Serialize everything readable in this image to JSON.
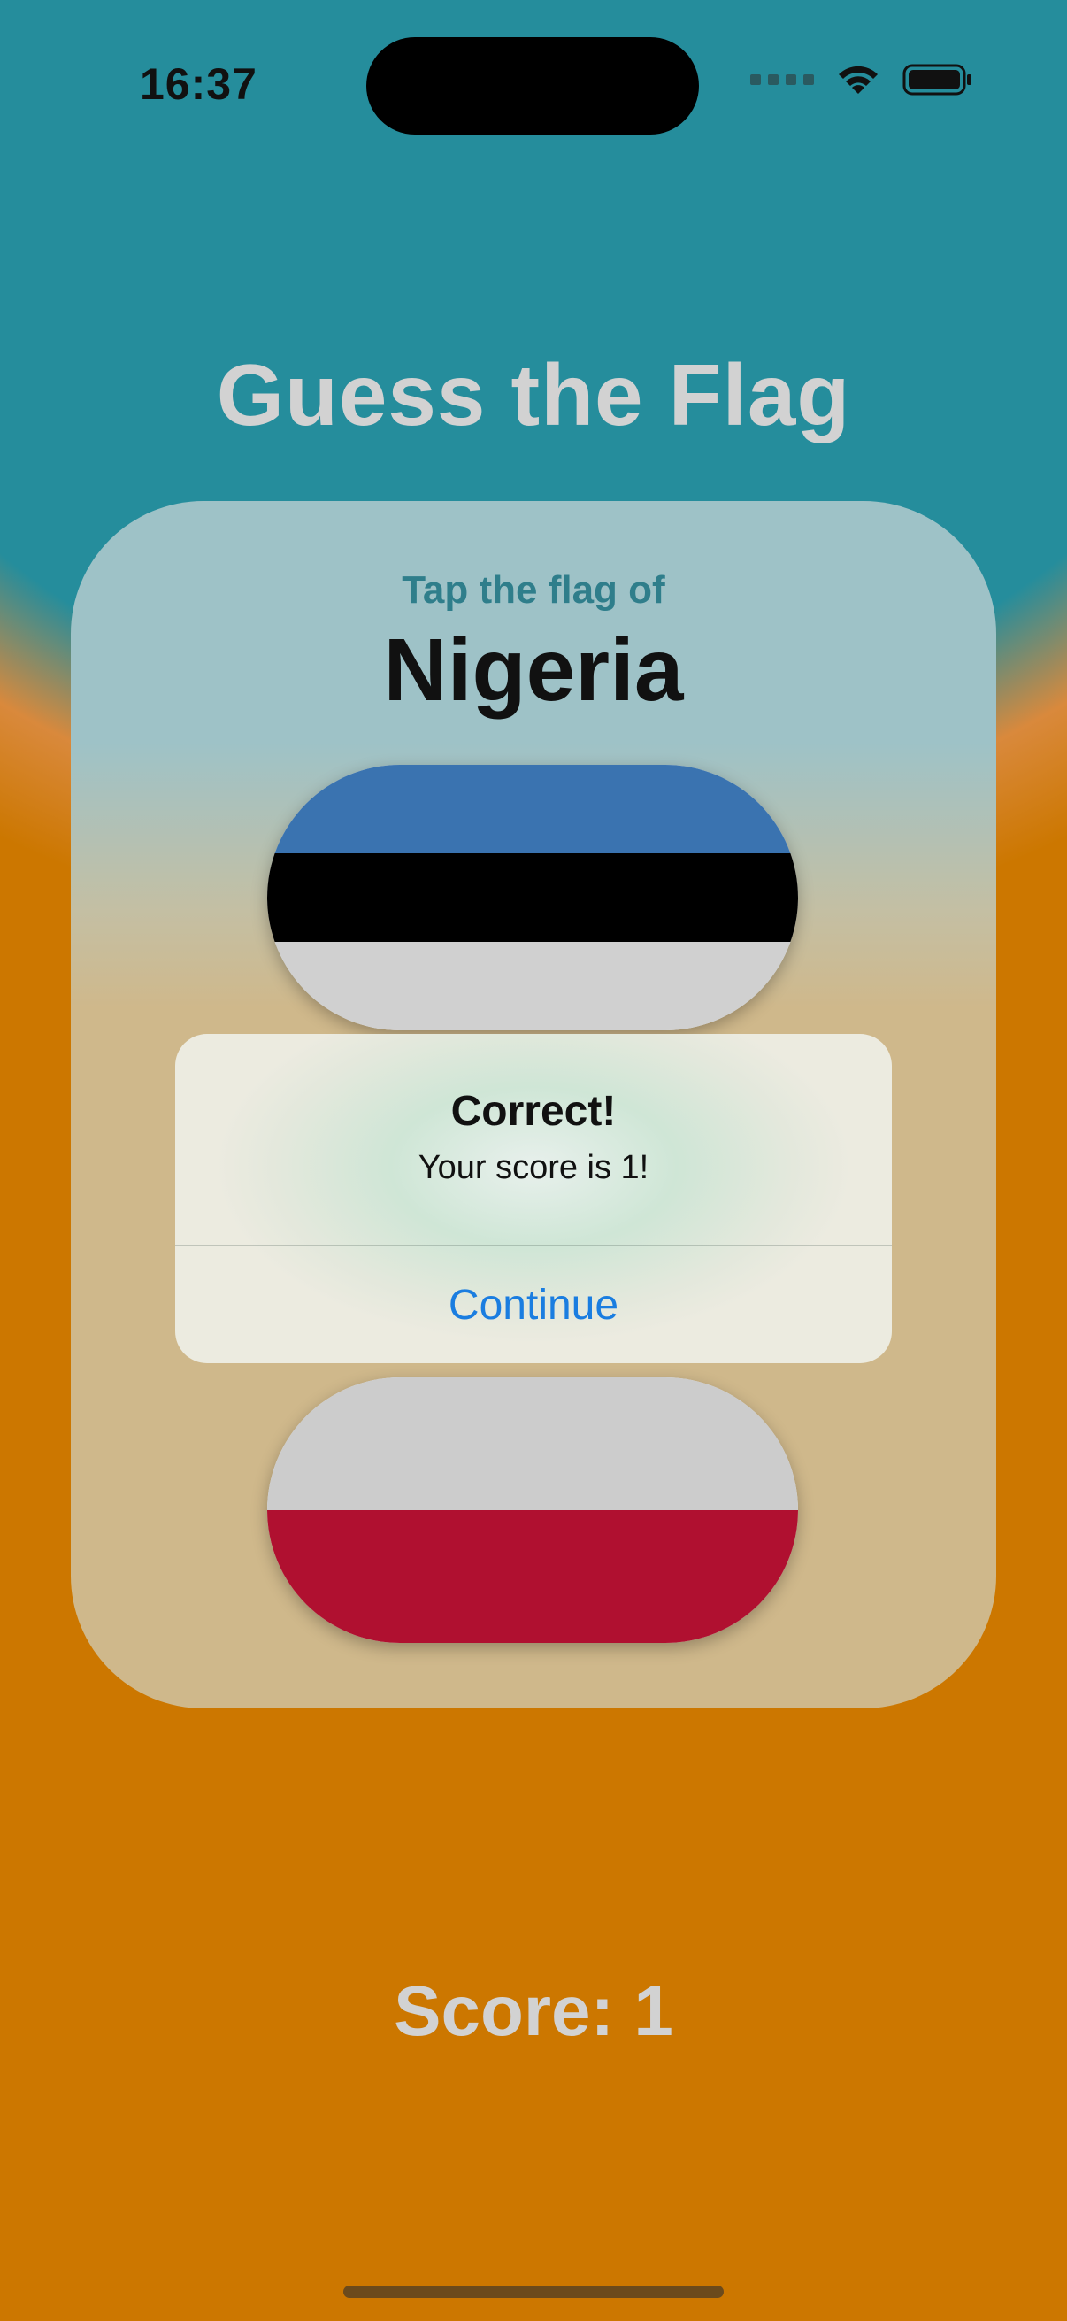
{
  "status_bar": {
    "time": "16:37",
    "icons": [
      "cellular-dots-icon",
      "wifi-icon",
      "battery-icon"
    ]
  },
  "app": {
    "title": "Guess the Flag"
  },
  "card": {
    "prompt": "Tap the flag of",
    "country": "Nigeria",
    "flags": [
      {
        "name": "Estonia",
        "stripes": [
          "#3a73b0",
          "#000000",
          "#d0d0d0"
        ]
      },
      {
        "name": "Poland",
        "stripes": [
          "#cccccc",
          "#b01030"
        ]
      }
    ]
  },
  "alert": {
    "title": "Correct!",
    "message": "Your score is 1!",
    "button": "Continue"
  },
  "footer": {
    "score": "Score: 1"
  },
  "colors": {
    "background_top": "#258d9c",
    "background_bottom": "#cc7700",
    "accent": "#1a7de0",
    "title_text": "#d2d2d2"
  }
}
